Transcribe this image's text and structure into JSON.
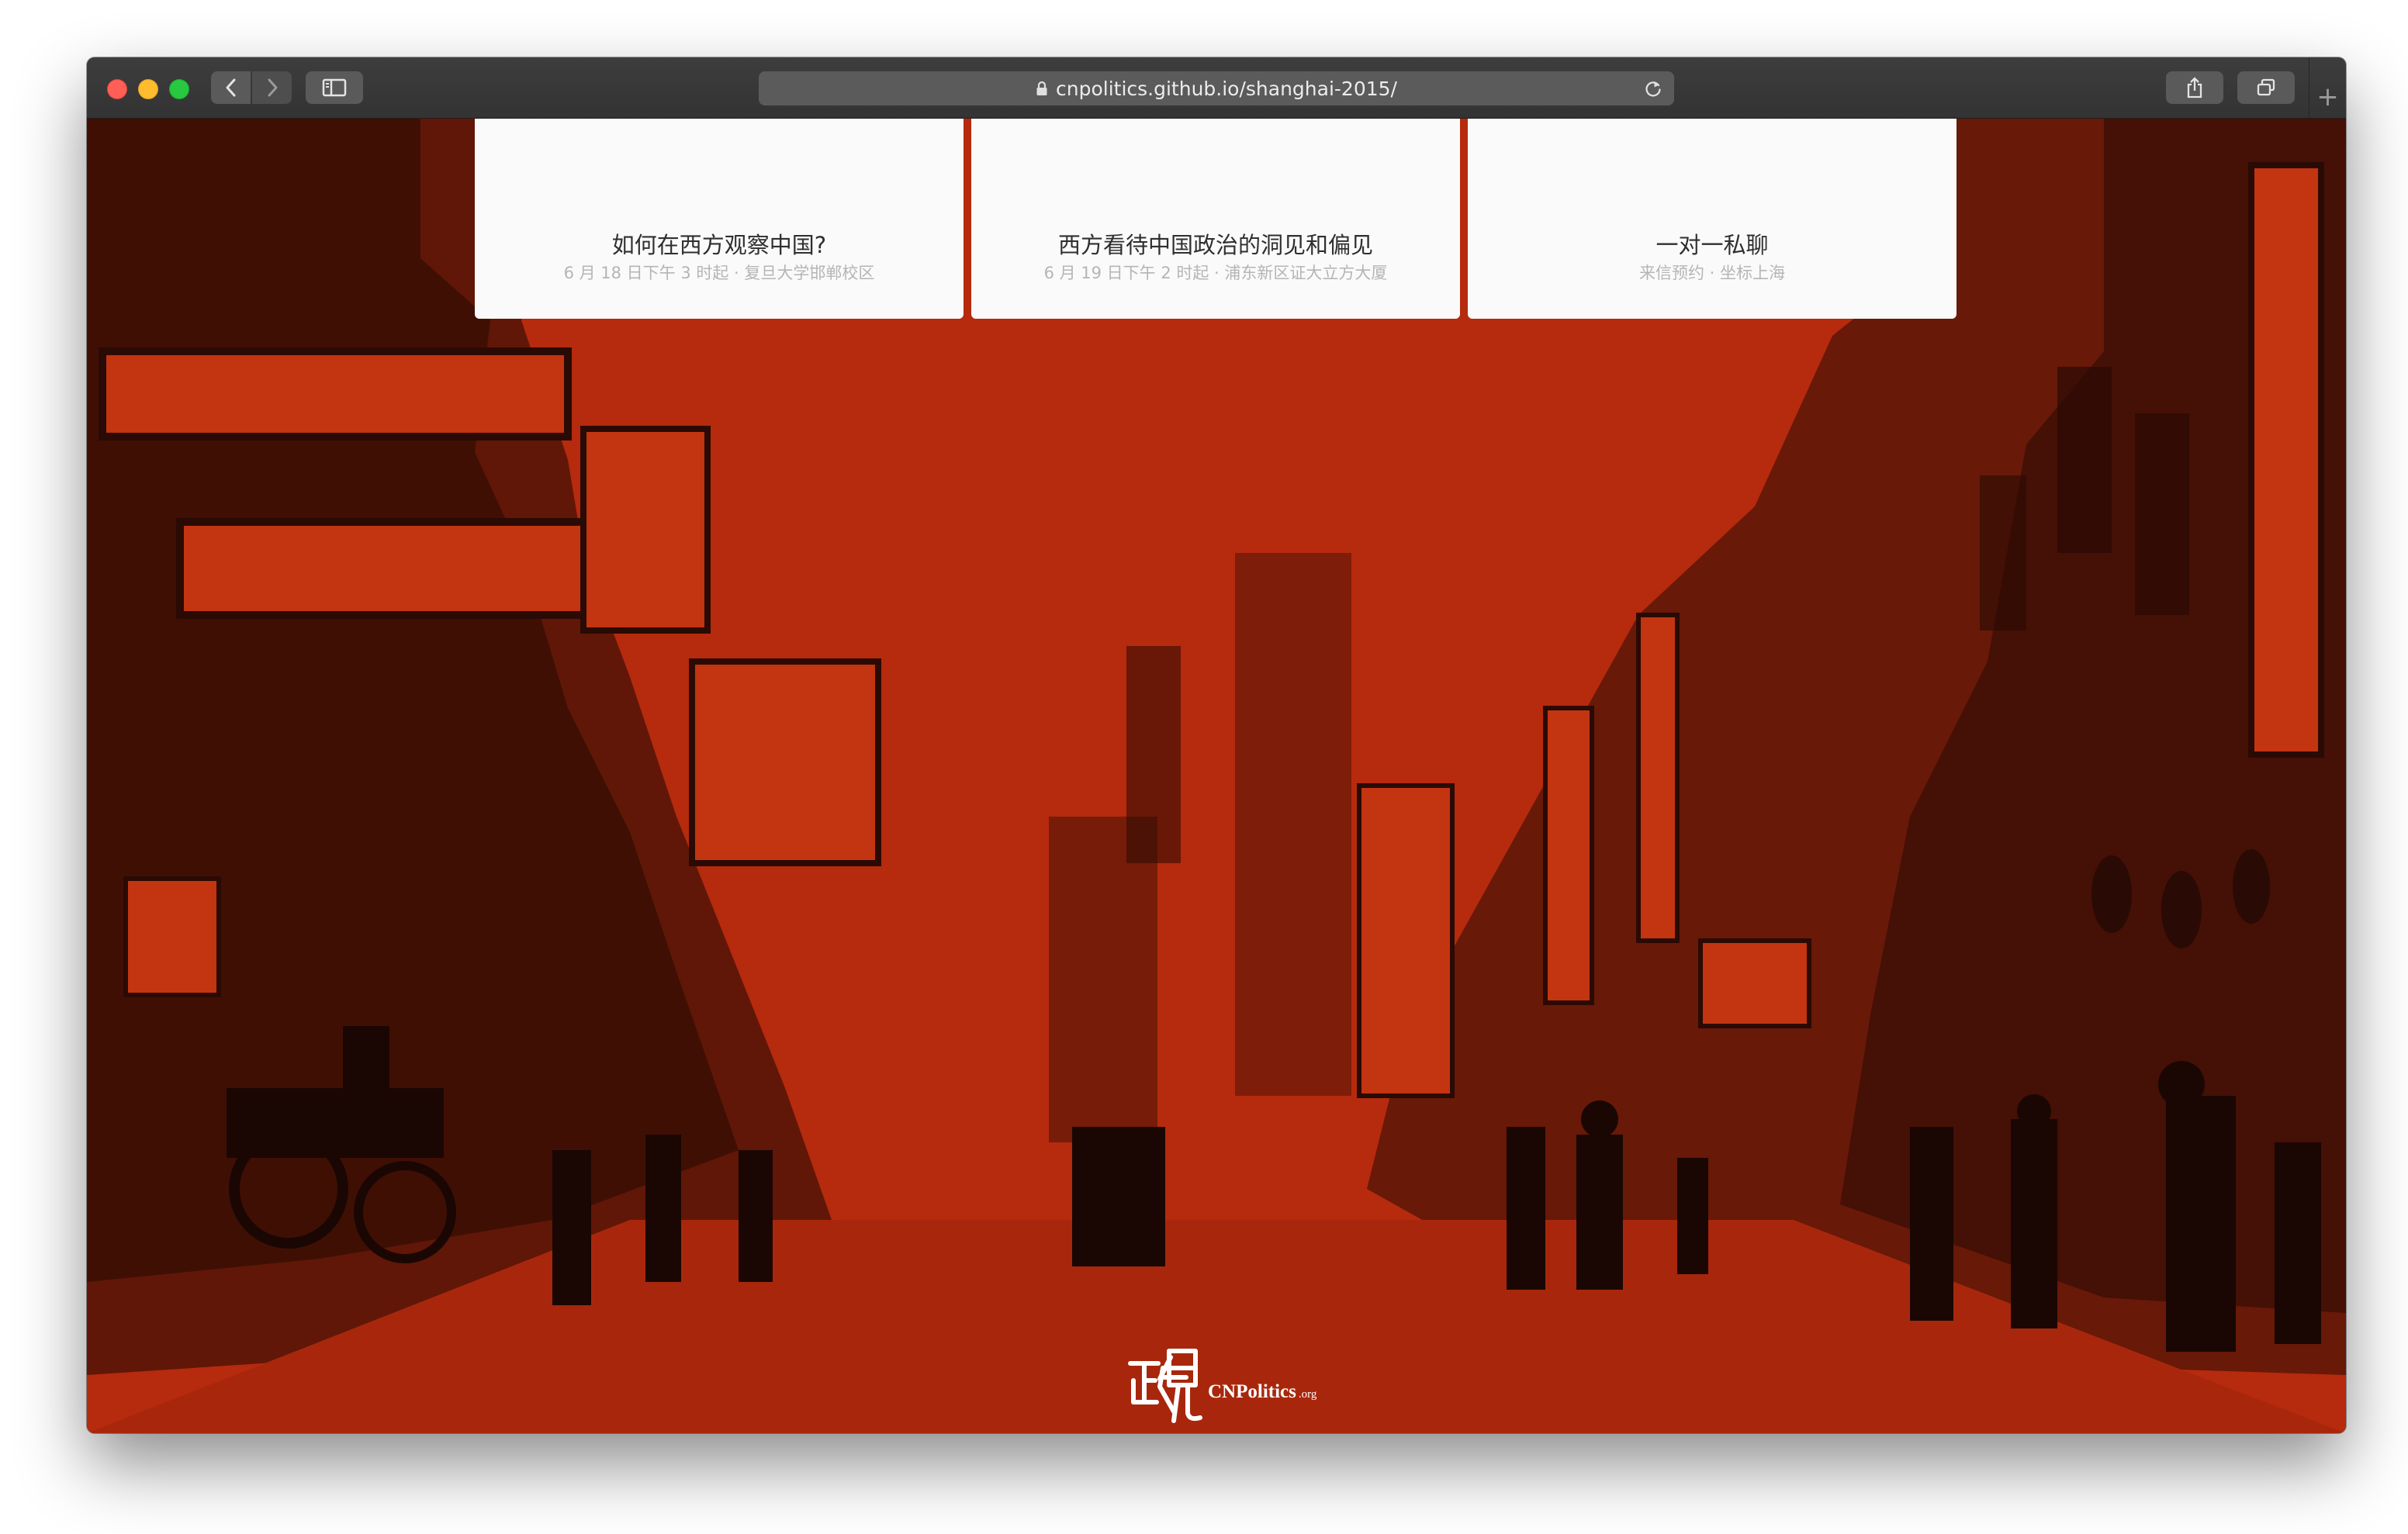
{
  "browser": {
    "url": "cnpolitics.github.io/shanghai-2015/",
    "new_tab_symbol": "+",
    "icons": {
      "close": "close-traffic-light",
      "minimize": "minimize-traffic-light",
      "maximize": "maximize-traffic-light",
      "back": "chevron-left-icon",
      "forward": "chevron-right-icon",
      "sidebar": "sidebar-icon",
      "lock": "lock-icon",
      "reload": "reload-icon",
      "share": "share-icon",
      "tabs": "tabs-overview-icon"
    }
  },
  "events": [
    {
      "title": "如何在西方观察中国?",
      "meta": "6 月 18 日下午 3 时起 · 复旦大学邯郸校区"
    },
    {
      "title": "西方看待中国政治的洞见和偏见",
      "meta": "6 月 19 日下午 2 时起 · 浦东新区证大立方大厦"
    },
    {
      "title": "一对一私聊",
      "meta": "来信预约 · 坐标上海"
    }
  ],
  "logo": {
    "name": "CNPolitics",
    "suffix": ".org"
  },
  "colors": {
    "page_background": "#b62a0d",
    "card_background": "#fafafa",
    "toolbar": "#383838"
  }
}
